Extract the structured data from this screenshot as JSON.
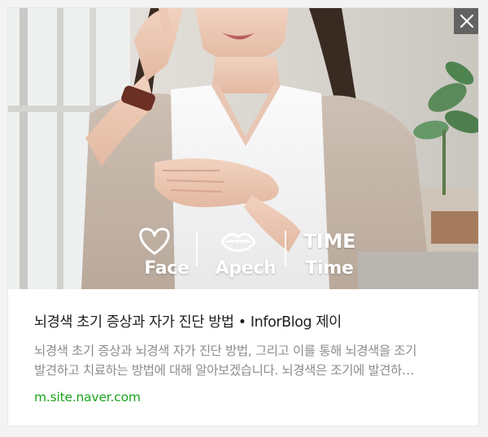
{
  "card": {
    "overlay": {
      "face_label": "Face",
      "apech_label": "Apech",
      "time_top": "TIME",
      "time_label": "Time"
    },
    "title": "뇌경색 초기 증상과 자가 진단 방법 • InforBlog 제이",
    "description_lines": [
      "뇌경색 초기 증상과 뇌경색 자가 진단 방법, 그리고 이를 통해 뇌경색을 조기",
      "발견하고 치료하는 방법에 대해 알아보겠습니다. 뇌경색은 조기에 발견하…"
    ],
    "source": "m.site.naver.com",
    "icons": {
      "close": "close-icon",
      "heart": "heart-icon",
      "lips": "lips-icon"
    },
    "colors": {
      "source_link": "#19a41c",
      "title": "#1e1e1e",
      "description": "#8c8c8c"
    }
  }
}
